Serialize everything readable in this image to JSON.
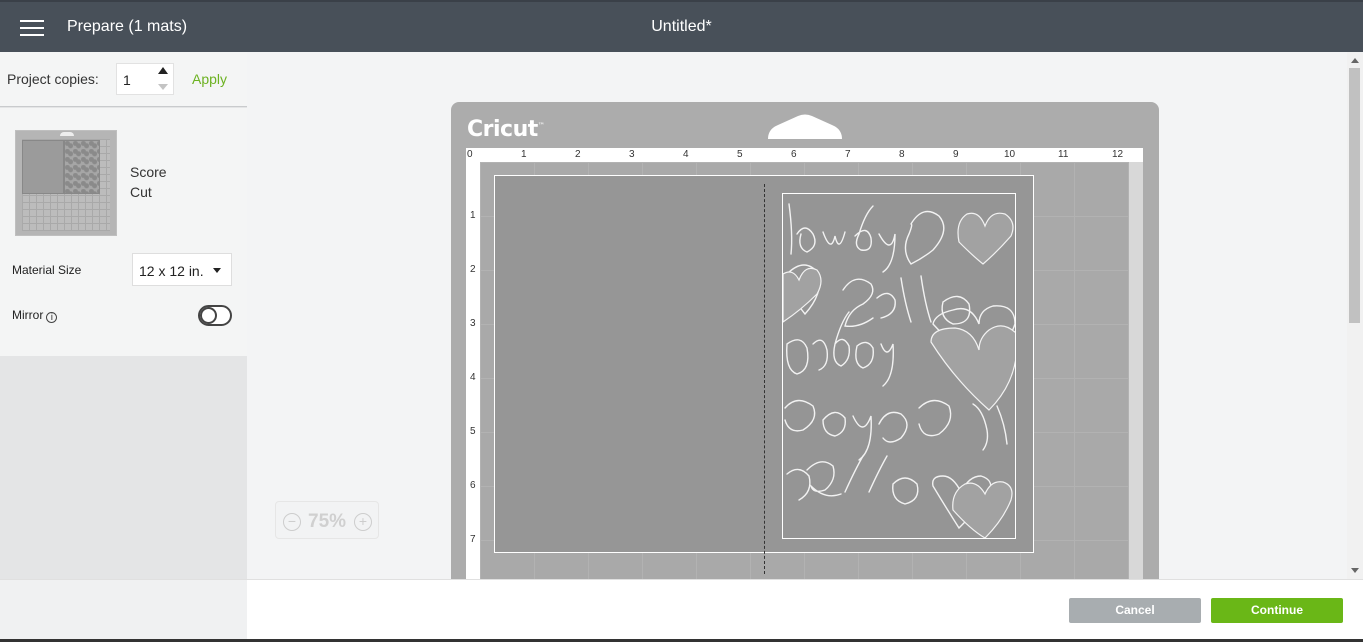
{
  "header": {
    "menu_icon": "hamburger-menu-icon",
    "prepare_title": "Prepare (1 mats)",
    "document_title": "Untitled*"
  },
  "sidebar": {
    "copies_label": "Project copies:",
    "copies_value": "1",
    "apply_label": "Apply",
    "mat_operations": [
      "Score",
      "Cut"
    ],
    "material_size_label": "Material Size",
    "material_size_value": "12 x 12 in.",
    "mirror_label": "Mirror",
    "mirror_on": false
  },
  "canvas": {
    "logo_text": "Cricut",
    "ruler_top": [
      "0",
      "1",
      "2",
      "3",
      "4",
      "5",
      "6",
      "7",
      "8",
      "9",
      "10",
      "11",
      "12"
    ],
    "ruler_left": [
      "1",
      "2",
      "3",
      "4",
      "5",
      "6",
      "7"
    ],
    "zoom_value": "75%",
    "zoom_minus": "−",
    "zoom_plus": "+"
  },
  "footer": {
    "cancel_label": "Cancel",
    "continue_label": "Continue"
  },
  "colors": {
    "header_bg": "#485059",
    "accent_green": "#6ab717",
    "cancel_gray": "#a8adb0"
  }
}
